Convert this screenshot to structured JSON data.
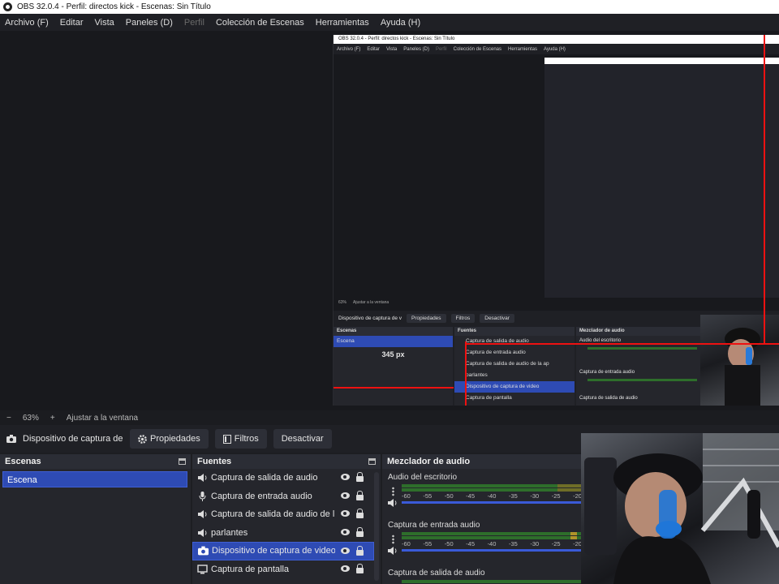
{
  "window": {
    "title": "OBS 32.0.4 - Perfil: directos kick - Escenas: Sin Título"
  },
  "menu": [
    "Archivo (F)",
    "Editar",
    "Vista",
    "Paneles (D)",
    "Perfil",
    "Colección de Escenas",
    "Herramientas",
    "Ayuda (H)"
  ],
  "preview": {
    "nested_title": "OBS 32.0.4 - Perfil: directos kick - Escenas: Sin Título",
    "nested_menu": [
      "Archivo (F)",
      "Editar",
      "Vista",
      "Paneles (D)",
      "Perfil",
      "Colección de Escenas",
      "Herramientas",
      "Ayuda (H)"
    ],
    "nested_zoom": "63%",
    "nested_fit": "Ajustar a la ventana",
    "nested_source": "Dispositivo de captura de v",
    "nested_props": "Propiedades",
    "nested_filters": "Filtros",
    "nested_deactivate": "Desactivar",
    "nested_scenes": "Escenas",
    "nested_scene": "Escena",
    "nested_sources": "Fuentes",
    "nested_mixer": "Mezclador de audio",
    "nested_desktop": "Audio del escritorio",
    "nested_mic": "Captura de entrada audio",
    "nested_out": "Captura de salida de audio",
    "measure": "345 px",
    "nested_source_rows": [
      "Captura de salida de audio",
      "Captura de entrada audio",
      "Captura de salida de audio de la ap",
      "parlantes",
      "Dispositivo de captura de video",
      "Captura de pantalla"
    ]
  },
  "zoom": {
    "minus": "−",
    "value": "63%",
    "plus": "+",
    "fit": "Ajustar a la ventana"
  },
  "controls": {
    "source_name": "Dispositivo de captura de v",
    "properties": "Propiedades",
    "filters": "Filtros",
    "deactivate": "Desactivar"
  },
  "scenes": {
    "title": "Escenas",
    "items": [
      "Escena"
    ]
  },
  "sources": {
    "title": "Fuentes",
    "items": [
      {
        "label": "Captura de salida de audio",
        "icon": "speaker-icon"
      },
      {
        "label": "Captura de entrada audio",
        "icon": "microphone-icon"
      },
      {
        "label": "Captura de salida de audio de la ap",
        "icon": "speaker-icon"
      },
      {
        "label": "parlantes",
        "icon": "speaker-icon"
      },
      {
        "label": "Dispositivo de captura de video",
        "icon": "camera-icon"
      },
      {
        "label": "Captura de pantalla",
        "icon": "monitor-icon"
      }
    ]
  },
  "mixer": {
    "title": "Mezclador de audio",
    "ticks": [
      "-60",
      "-55",
      "-50",
      "-45",
      "-40",
      "-35",
      "-30",
      "-25",
      "-20"
    ],
    "channels": [
      "Audio del escritorio",
      "Captura de entrada audio",
      "Captura de salida de audio"
    ]
  },
  "colors": {
    "selection": "#2e4bb4",
    "meter_green": "#2e6e2b",
    "fader_blue": "#3a5ad8",
    "guide_red": "#e11111"
  }
}
